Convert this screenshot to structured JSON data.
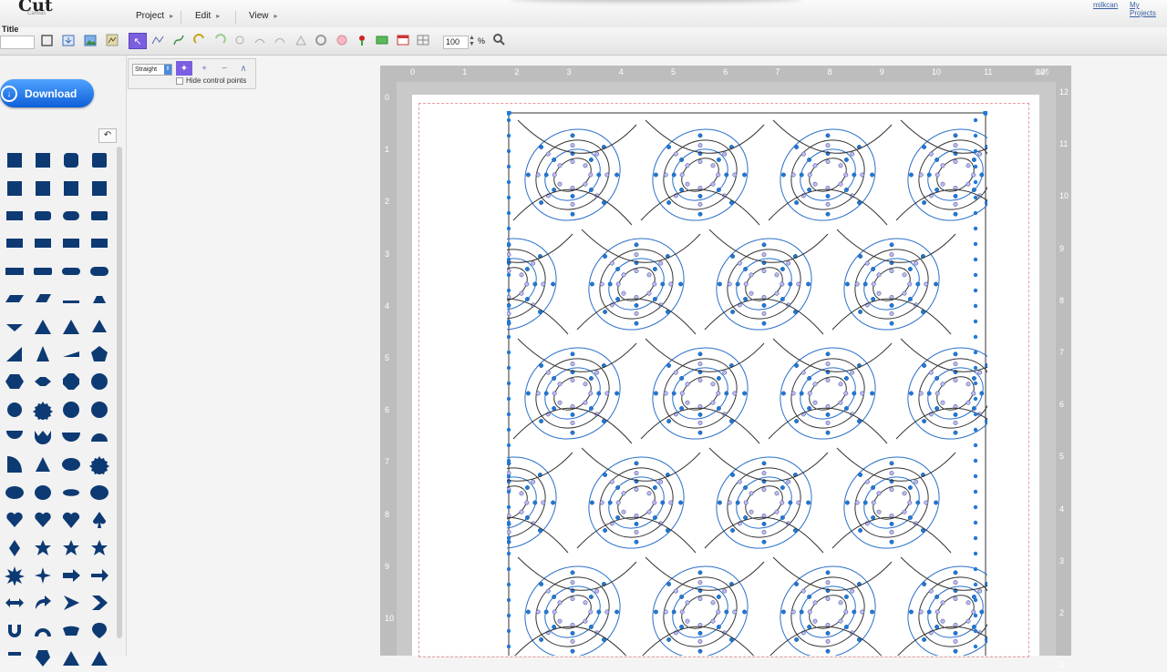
{
  "app": {
    "logo_text": "Cut",
    "logo_sub": "Canvas"
  },
  "menus": [
    "Project",
    "Edit",
    "View"
  ],
  "user": {
    "name": "milkcan",
    "projects_link": "My Projects"
  },
  "toolbar": {
    "title_label": "Title",
    "title_value": "",
    "zoom_value": "100",
    "zoom_unit": "%",
    "tools": [
      "rectangle-tool",
      "import-tool",
      "image-tool",
      "trace-tool",
      "select-node-tool",
      "line-tool",
      "pen-tool",
      "undo-tool",
      "redo-tool",
      "path-tool",
      "pencil-tool",
      "eraser-tool",
      "circle-tool",
      "fill-tool",
      "drop-tool",
      "crop-tool",
      "grid-tool"
    ]
  },
  "left_panel": {
    "download_label": "Download",
    "undo_label": "↶"
  },
  "popup": {
    "mode_value": "Straight",
    "hide_cp_label": "Hide control points"
  },
  "ruler": {
    "top_labels": [
      "0",
      "1",
      "2",
      "3",
      "4",
      "5",
      "6",
      "7",
      "8",
      "9",
      "10",
      "11",
      "12\""
    ],
    "top_unit": "(inch)",
    "left_labels": [
      "0",
      "1",
      "2",
      "3",
      "4",
      "5",
      "6",
      "7",
      "8",
      "9",
      "10"
    ],
    "right_labels": [
      "12",
      "11",
      "10",
      "9",
      "8",
      "7",
      "6",
      "5",
      "4",
      "3",
      "2",
      "1"
    ]
  },
  "colors": {
    "accent": "#0f5ed8",
    "shape_fill": "#0d3a73",
    "node_blue": "#1f7ad9",
    "select_purple": "#7b5fe0",
    "mat_gray": "#c9c9c9",
    "cutline_red": "#e79ea3"
  }
}
